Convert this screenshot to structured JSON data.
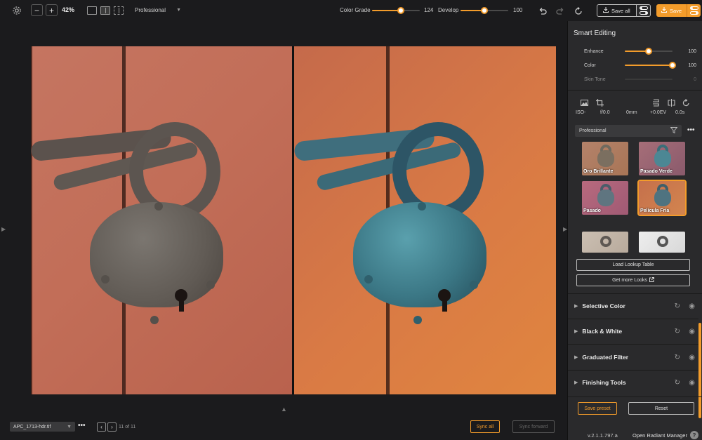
{
  "toolbar": {
    "zoom_value": "42%",
    "preset_dropdown": "Professional",
    "color_grade_label": "Color Grade",
    "color_grade_value": "124",
    "color_grade_fraction": 0.6,
    "develop_label": "Develop",
    "develop_value": "100",
    "develop_fraction": 0.5,
    "save_all_label": "Save all",
    "save_label": "Save",
    "accent_color": "#f39c2b"
  },
  "smart_editing": {
    "title": "Smart Editing",
    "sliders": [
      {
        "label": "Enhance",
        "value": "100",
        "fraction": 0.5
      },
      {
        "label": "Color",
        "value": "100",
        "fraction": 1.0
      },
      {
        "label": "Skin Tone",
        "value": "0",
        "fraction": 0.0
      }
    ]
  },
  "info": {
    "iso": "ISO-",
    "aperture": "f/0.0",
    "focal": "0mm",
    "exposure": "+0.0EV",
    "shutter": "0.0s"
  },
  "looks": {
    "category": "Professional",
    "items": [
      {
        "label": "Oro Brillante"
      },
      {
        "label": "Pasado Verde"
      },
      {
        "label": "Pasado"
      },
      {
        "label": "Película Fría",
        "selected": true
      },
      {
        "label": ""
      },
      {
        "label": ""
      }
    ],
    "load_lut_label": "Load Lookup Table",
    "more_looks_label": "Get more Looks"
  },
  "sections": [
    {
      "name": "Selective Color"
    },
    {
      "name": "Black & White"
    },
    {
      "name": "Graduated Filter"
    },
    {
      "name": "Finishing Tools"
    }
  ],
  "panel_footer": {
    "save_preset_label": "Save preset",
    "reset_label": "Reset",
    "version": "v.2.1.1.797.a",
    "manager_label": "Open Radiant Manager",
    "help_label": "?"
  },
  "bottom": {
    "file_name": "APC_1713-hdr.tif",
    "page_counter": "11 of 11",
    "sync_all_label": "Sync all",
    "sync_forward_label": "Sync forward"
  },
  "icons": [
    "settings-icon",
    "zoom-out-icon",
    "zoom-in-icon",
    "single-view-icon",
    "split-view-icon",
    "side-by-side-icon",
    "undo-icon",
    "redo-icon",
    "reset-icon",
    "download-icon",
    "toggle-icon",
    "image-icon",
    "crop-icon",
    "filter-icon",
    "eye-icon",
    "refresh-icon",
    "external-link-icon"
  ]
}
